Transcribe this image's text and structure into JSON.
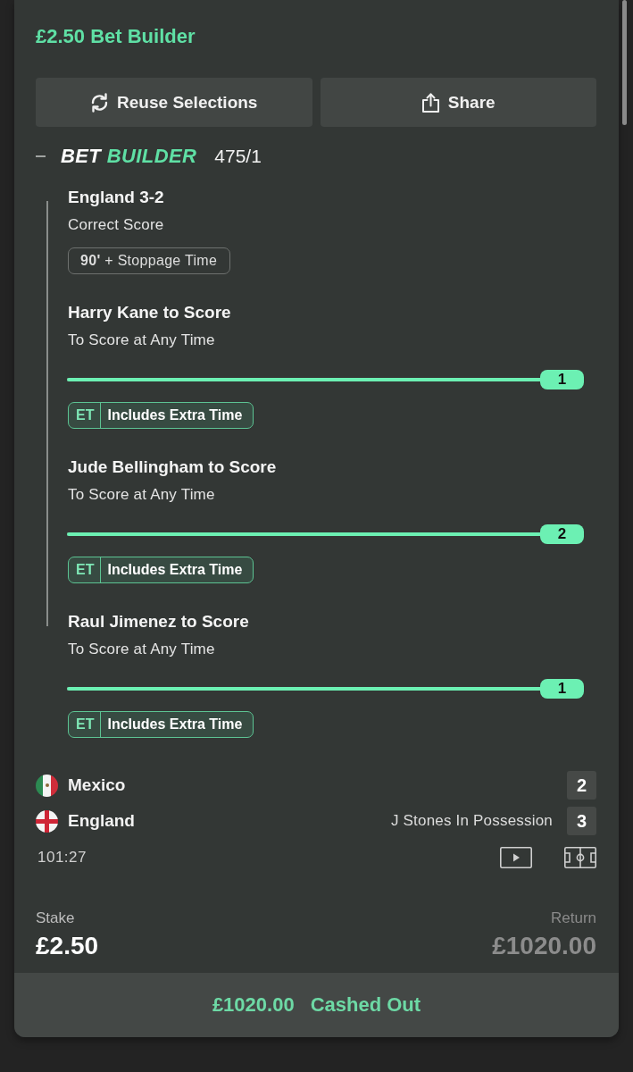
{
  "header": {
    "title": "£2.50 Bet Builder"
  },
  "actions": [
    {
      "kind": "reuse",
      "label": "Reuse Selections"
    },
    {
      "kind": "share",
      "label": "Share"
    }
  ],
  "bet_builder": {
    "expanded": true,
    "logo_parts": [
      "BET",
      "BUILDER"
    ],
    "odds": "475/1"
  },
  "selections": [
    {
      "kind": "score",
      "title": "England 3-2",
      "market": "Correct Score",
      "tag": {
        "kind": "stoppage",
        "text": "**90'** + Stoppage Time"
      }
    },
    {
      "kind": "scorer",
      "title": "Harry Kane to Score",
      "market": "To Score at Any Time",
      "progress": {
        "level": 1,
        "count": "1"
      },
      "tag": {
        "kind": "extra_time",
        "abbr": "ET",
        "text": "Includes Extra Time"
      }
    },
    {
      "kind": "scorer",
      "title": "Jude Bellingham to Score",
      "market": "To Score at Any Time",
      "progress": {
        "level": 1,
        "count": "2"
      },
      "tag": {
        "kind": "extra_time",
        "abbr": "ET",
        "text": "Includes Extra Time"
      }
    },
    {
      "kind": "scorer",
      "title": "Raul Jimenez to Score",
      "market": "To Score at Any Time",
      "progress": {
        "level": 1,
        "count": "1"
      },
      "tag": {
        "kind": "extra_time",
        "abbr": "ET",
        "text": "Includes Extra Time"
      }
    }
  ],
  "match": {
    "teams": [
      {
        "kind": "mexico",
        "name": "Mexico",
        "score": "2"
      },
      {
        "kind": "england",
        "name": "England",
        "status": "J Stones In Possession",
        "score": "3"
      }
    ],
    "clock": "101:27"
  },
  "stake": {
    "label": "Stake",
    "value": "£2.50"
  },
  "return": {
    "label": "Return",
    "value": "£1020.00"
  },
  "cash_out": {
    "amount": "£1020.00",
    "status": "Cashed Out"
  }
}
